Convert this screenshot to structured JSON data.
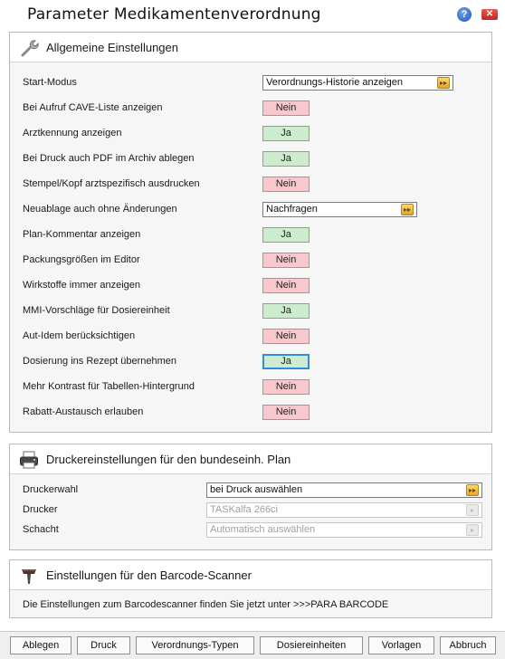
{
  "window": {
    "title": "Parameter Medikamentenverordnung"
  },
  "general": {
    "title": "Allgemeine Einstellungen",
    "start_mode": {
      "label": "Start-Modus",
      "value": "Verordnungs-Historie anzeigen"
    },
    "new_storage": {
      "label": "Neuablage auch ohne Änderungen",
      "value": "Nachfragen"
    },
    "rows": [
      {
        "label": "Bei Aufruf CAVE-Liste anzeigen",
        "value": "Nein"
      },
      {
        "label": "Arztkennung anzeigen",
        "value": "Ja"
      },
      {
        "label": "Bei Druck auch PDF im Archiv ablegen",
        "value": "Ja"
      },
      {
        "label": "Stempel/Kopf arztspezifisch ausdrucken",
        "value": "Nein"
      },
      {
        "label": "Plan-Kommentar anzeigen",
        "value": "Ja"
      },
      {
        "label": "Packungsgrößen im Editor",
        "value": "Nein"
      },
      {
        "label": "Wirkstoffe immer anzeigen",
        "value": "Nein"
      },
      {
        "label": "MMI-Vorschläge für Dosiereinheit",
        "value": "Ja"
      },
      {
        "label": "Aut-Idem berücksichtigen",
        "value": "Nein"
      },
      {
        "label": "Dosierung ins Rezept übernehmen",
        "value": "Ja"
      },
      {
        "label": "Mehr Kontrast für Tabellen-Hintergrund",
        "value": "Nein"
      },
      {
        "label": "Rabatt-Austausch erlauben",
        "value": "Nein"
      }
    ]
  },
  "printer": {
    "title": "Druckereinstellungen für den bundeseinh. Plan",
    "choice": {
      "label": "Druckerwahl",
      "value": "bei Druck auswählen"
    },
    "device": {
      "label": "Drucker",
      "value": "TASKalfa 266ci"
    },
    "tray": {
      "label": "Schacht",
      "value": "Automatisch auswählen"
    }
  },
  "scanner": {
    "title": "Einstellungen für den Barcode-Scanner",
    "note": "Die Einstellungen zum Barcodescanner finden Sie jetzt unter >>>PARA BARCODE"
  },
  "footer": {
    "buttons": [
      "Ablegen",
      "Druck",
      "Verordnungs-Typen",
      "Dosiereinheiten",
      "Vorlagen",
      "Abbruch"
    ]
  }
}
